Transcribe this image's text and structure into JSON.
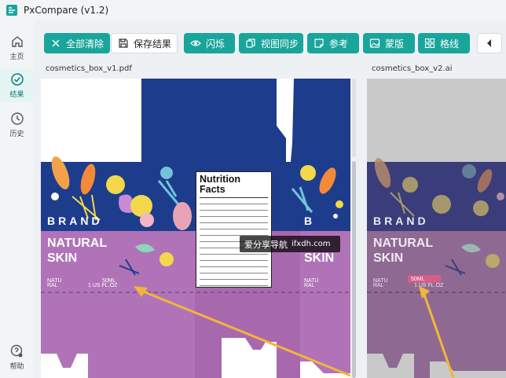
{
  "window": {
    "title": "PxCompare (v1.2)"
  },
  "rail": {
    "items": [
      {
        "label": "主页",
        "icon": "home-icon"
      },
      {
        "label": "结果",
        "icon": "check-circle-icon",
        "active": true
      },
      {
        "label": "历史",
        "icon": "history-icon"
      },
      {
        "label": "帮助",
        "icon": "help-icon"
      }
    ]
  },
  "toolbar": {
    "clear_all": "全部清除",
    "save_result": "保存结果",
    "flash": "闪烁",
    "sync_view": "视图同步",
    "reference": "参考",
    "overlay": "蒙版",
    "checkerboard": "格线"
  },
  "panes": {
    "left_file": "cosmetics_box_v1.pdf",
    "right_file": "cosmetics_box_v2.ai"
  },
  "artwork": {
    "brand": "BRAND",
    "product_line1": "NATURAL",
    "product_line2": "SKIN",
    "natu_line1": "NATU",
    "natu_line2": "RAL",
    "volume_ml": "50ML",
    "volume_floz": "1 US FL.OZ",
    "right_product_line1": "NATUR",
    "nutrition_title": "Nutrition Facts",
    "right_volume_ml": "50ML",
    "right_volume_floz": "1 US FL.OZ"
  },
  "watermark": {
    "text": "爱分享导航",
    "site": "ifxdh.com"
  },
  "colors": {
    "accent": "#19a59b",
    "box_blue": "#1e3c8c",
    "box_purple": "#b073b8",
    "highlight_diff": "#e05a8a",
    "arrow": "#f2b53a"
  }
}
